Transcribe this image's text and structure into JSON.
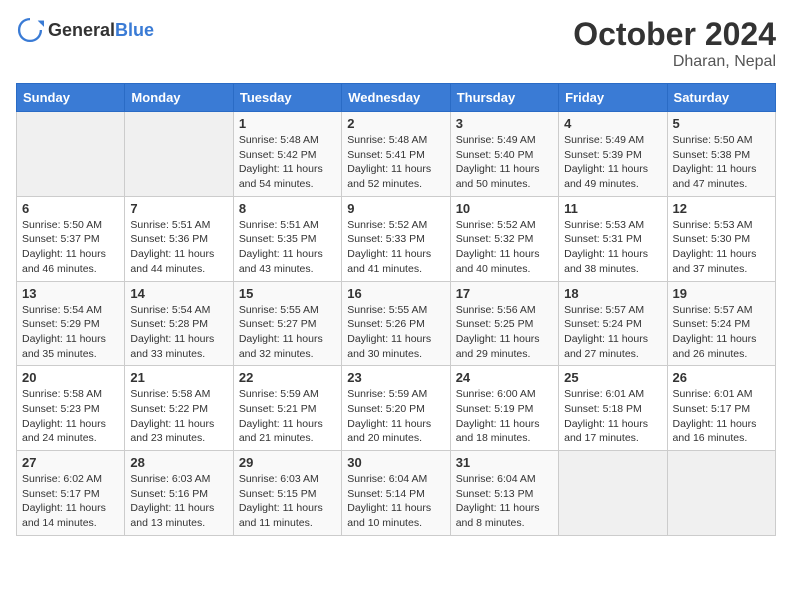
{
  "header": {
    "logo_general": "General",
    "logo_blue": "Blue",
    "month": "October 2024",
    "location": "Dharan, Nepal"
  },
  "weekdays": [
    "Sunday",
    "Monday",
    "Tuesday",
    "Wednesday",
    "Thursday",
    "Friday",
    "Saturday"
  ],
  "weeks": [
    [
      {
        "day": "",
        "sunrise": "",
        "sunset": "",
        "daylight": ""
      },
      {
        "day": "",
        "sunrise": "",
        "sunset": "",
        "daylight": ""
      },
      {
        "day": "1",
        "sunrise": "Sunrise: 5:48 AM",
        "sunset": "Sunset: 5:42 PM",
        "daylight": "Daylight: 11 hours and 54 minutes."
      },
      {
        "day": "2",
        "sunrise": "Sunrise: 5:48 AM",
        "sunset": "Sunset: 5:41 PM",
        "daylight": "Daylight: 11 hours and 52 minutes."
      },
      {
        "day": "3",
        "sunrise": "Sunrise: 5:49 AM",
        "sunset": "Sunset: 5:40 PM",
        "daylight": "Daylight: 11 hours and 50 minutes."
      },
      {
        "day": "4",
        "sunrise": "Sunrise: 5:49 AM",
        "sunset": "Sunset: 5:39 PM",
        "daylight": "Daylight: 11 hours and 49 minutes."
      },
      {
        "day": "5",
        "sunrise": "Sunrise: 5:50 AM",
        "sunset": "Sunset: 5:38 PM",
        "daylight": "Daylight: 11 hours and 47 minutes."
      }
    ],
    [
      {
        "day": "6",
        "sunrise": "Sunrise: 5:50 AM",
        "sunset": "Sunset: 5:37 PM",
        "daylight": "Daylight: 11 hours and 46 minutes."
      },
      {
        "day": "7",
        "sunrise": "Sunrise: 5:51 AM",
        "sunset": "Sunset: 5:36 PM",
        "daylight": "Daylight: 11 hours and 44 minutes."
      },
      {
        "day": "8",
        "sunrise": "Sunrise: 5:51 AM",
        "sunset": "Sunset: 5:35 PM",
        "daylight": "Daylight: 11 hours and 43 minutes."
      },
      {
        "day": "9",
        "sunrise": "Sunrise: 5:52 AM",
        "sunset": "Sunset: 5:33 PM",
        "daylight": "Daylight: 11 hours and 41 minutes."
      },
      {
        "day": "10",
        "sunrise": "Sunrise: 5:52 AM",
        "sunset": "Sunset: 5:32 PM",
        "daylight": "Daylight: 11 hours and 40 minutes."
      },
      {
        "day": "11",
        "sunrise": "Sunrise: 5:53 AM",
        "sunset": "Sunset: 5:31 PM",
        "daylight": "Daylight: 11 hours and 38 minutes."
      },
      {
        "day": "12",
        "sunrise": "Sunrise: 5:53 AM",
        "sunset": "Sunset: 5:30 PM",
        "daylight": "Daylight: 11 hours and 37 minutes."
      }
    ],
    [
      {
        "day": "13",
        "sunrise": "Sunrise: 5:54 AM",
        "sunset": "Sunset: 5:29 PM",
        "daylight": "Daylight: 11 hours and 35 minutes."
      },
      {
        "day": "14",
        "sunrise": "Sunrise: 5:54 AM",
        "sunset": "Sunset: 5:28 PM",
        "daylight": "Daylight: 11 hours and 33 minutes."
      },
      {
        "day": "15",
        "sunrise": "Sunrise: 5:55 AM",
        "sunset": "Sunset: 5:27 PM",
        "daylight": "Daylight: 11 hours and 32 minutes."
      },
      {
        "day": "16",
        "sunrise": "Sunrise: 5:55 AM",
        "sunset": "Sunset: 5:26 PM",
        "daylight": "Daylight: 11 hours and 30 minutes."
      },
      {
        "day": "17",
        "sunrise": "Sunrise: 5:56 AM",
        "sunset": "Sunset: 5:25 PM",
        "daylight": "Daylight: 11 hours and 29 minutes."
      },
      {
        "day": "18",
        "sunrise": "Sunrise: 5:57 AM",
        "sunset": "Sunset: 5:24 PM",
        "daylight": "Daylight: 11 hours and 27 minutes."
      },
      {
        "day": "19",
        "sunrise": "Sunrise: 5:57 AM",
        "sunset": "Sunset: 5:24 PM",
        "daylight": "Daylight: 11 hours and 26 minutes."
      }
    ],
    [
      {
        "day": "20",
        "sunrise": "Sunrise: 5:58 AM",
        "sunset": "Sunset: 5:23 PM",
        "daylight": "Daylight: 11 hours and 24 minutes."
      },
      {
        "day": "21",
        "sunrise": "Sunrise: 5:58 AM",
        "sunset": "Sunset: 5:22 PM",
        "daylight": "Daylight: 11 hours and 23 minutes."
      },
      {
        "day": "22",
        "sunrise": "Sunrise: 5:59 AM",
        "sunset": "Sunset: 5:21 PM",
        "daylight": "Daylight: 11 hours and 21 minutes."
      },
      {
        "day": "23",
        "sunrise": "Sunrise: 5:59 AM",
        "sunset": "Sunset: 5:20 PM",
        "daylight": "Daylight: 11 hours and 20 minutes."
      },
      {
        "day": "24",
        "sunrise": "Sunrise: 6:00 AM",
        "sunset": "Sunset: 5:19 PM",
        "daylight": "Daylight: 11 hours and 18 minutes."
      },
      {
        "day": "25",
        "sunrise": "Sunrise: 6:01 AM",
        "sunset": "Sunset: 5:18 PM",
        "daylight": "Daylight: 11 hours and 17 minutes."
      },
      {
        "day": "26",
        "sunrise": "Sunrise: 6:01 AM",
        "sunset": "Sunset: 5:17 PM",
        "daylight": "Daylight: 11 hours and 16 minutes."
      }
    ],
    [
      {
        "day": "27",
        "sunrise": "Sunrise: 6:02 AM",
        "sunset": "Sunset: 5:17 PM",
        "daylight": "Daylight: 11 hours and 14 minutes."
      },
      {
        "day": "28",
        "sunrise": "Sunrise: 6:03 AM",
        "sunset": "Sunset: 5:16 PM",
        "daylight": "Daylight: 11 hours and 13 minutes."
      },
      {
        "day": "29",
        "sunrise": "Sunrise: 6:03 AM",
        "sunset": "Sunset: 5:15 PM",
        "daylight": "Daylight: 11 hours and 11 minutes."
      },
      {
        "day": "30",
        "sunrise": "Sunrise: 6:04 AM",
        "sunset": "Sunset: 5:14 PM",
        "daylight": "Daylight: 11 hours and 10 minutes."
      },
      {
        "day": "31",
        "sunrise": "Sunrise: 6:04 AM",
        "sunset": "Sunset: 5:13 PM",
        "daylight": "Daylight: 11 hours and 8 minutes."
      },
      {
        "day": "",
        "sunrise": "",
        "sunset": "",
        "daylight": ""
      },
      {
        "day": "",
        "sunrise": "",
        "sunset": "",
        "daylight": ""
      }
    ]
  ]
}
